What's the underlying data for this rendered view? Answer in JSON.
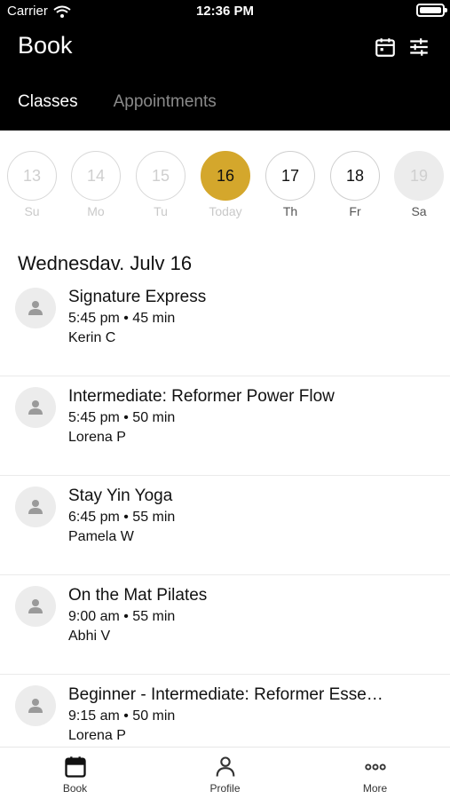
{
  "status_bar": {
    "carrier": "Carrier",
    "time": "12:36 PM"
  },
  "header": {
    "title": "Book",
    "tabs": [
      {
        "label": "Classes",
        "active": true
      },
      {
        "label": "Appointments",
        "active": false
      }
    ],
    "icons": [
      "calendar-icon",
      "filter-sliders-icon"
    ]
  },
  "dates": [
    {
      "num": "13",
      "label": "Su",
      "state": "past"
    },
    {
      "num": "14",
      "label": "Mo",
      "state": "past"
    },
    {
      "num": "15",
      "label": "Tu",
      "state": "past"
    },
    {
      "num": "16",
      "label": "Today",
      "state": "selected"
    },
    {
      "num": "17",
      "label": "Th",
      "state": "available"
    },
    {
      "num": "18",
      "label": "Fr",
      "state": "available"
    },
    {
      "num": "19",
      "label": "Sa",
      "state": "unavailable"
    }
  ],
  "colors": {
    "accent": "#d4a72c",
    "header_bg": "#000000"
  },
  "date_heading": "Wednesdav. Julv 16",
  "classes": [
    {
      "name": "Signature Express",
      "time": "5:45 pm • 45 min",
      "instructor": "Kerin C"
    },
    {
      "name": "Intermediate: Reformer Power Flow",
      "time": "5:45 pm • 50 min",
      "instructor": "Lorena P"
    },
    {
      "name": "Stay Yin Yoga",
      "time": "6:45 pm • 55 min",
      "instructor": "Pamela W"
    },
    {
      "name": "On the Mat Pilates",
      "time": "9:00 am • 55 min",
      "instructor": "Abhi V"
    },
    {
      "name": "Beginner - Intermediate: Reformer Esse…",
      "time": "9:15 am • 50 min",
      "instructor": "Lorena P"
    }
  ],
  "tabbar": [
    {
      "label": "Book",
      "icon": "calendar-icon"
    },
    {
      "label": "Profile",
      "icon": "person-icon"
    },
    {
      "label": "More",
      "icon": "more-dots-icon"
    }
  ]
}
